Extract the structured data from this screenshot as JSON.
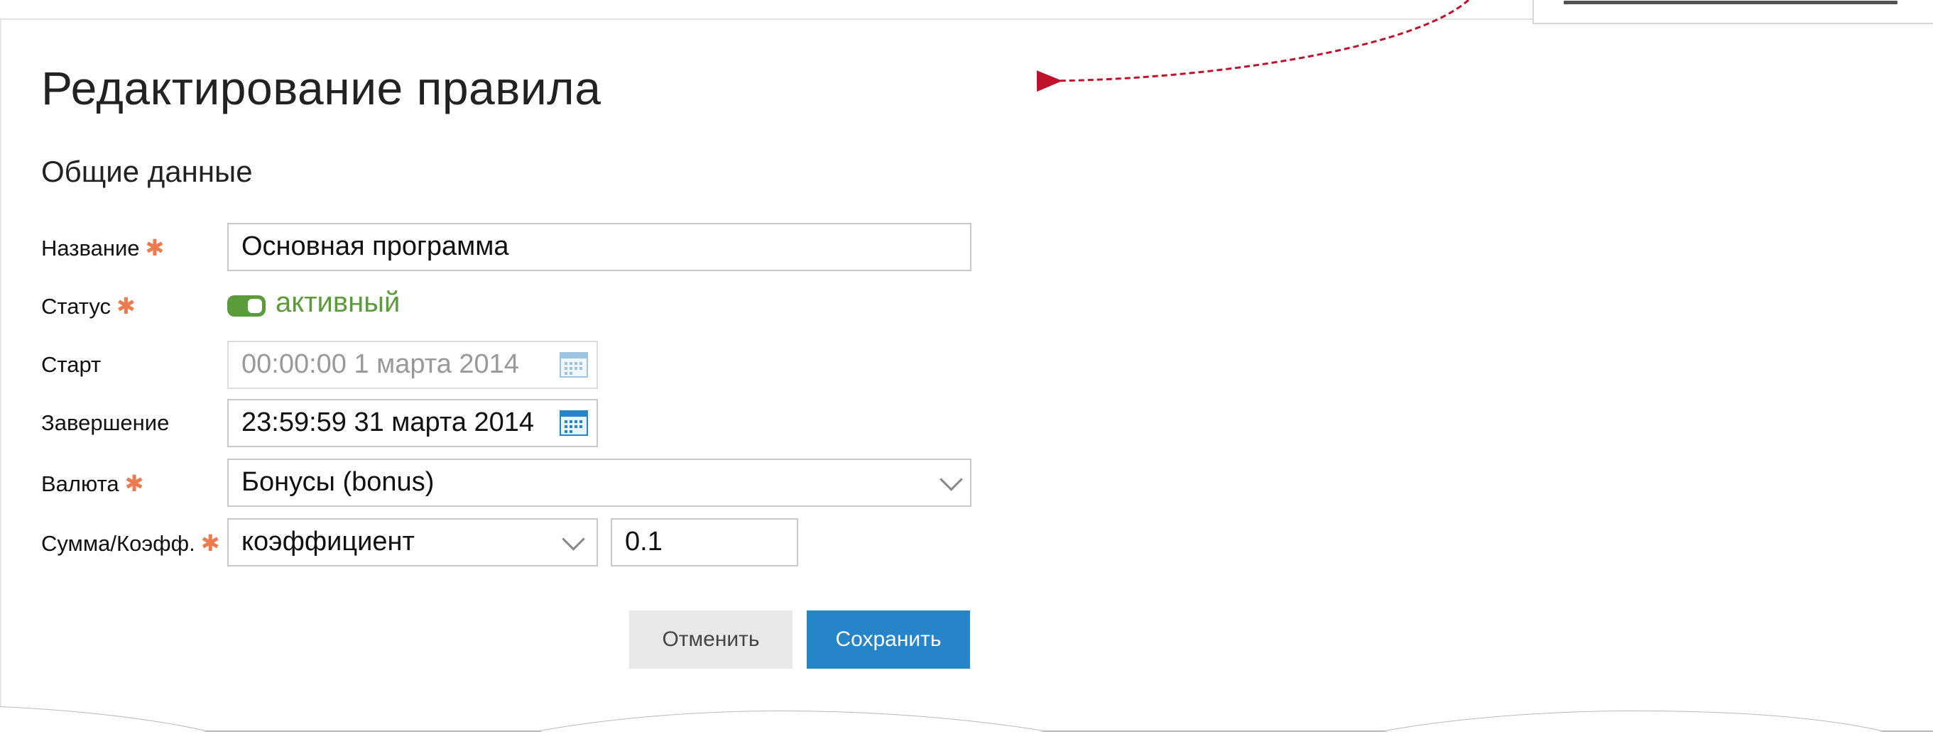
{
  "page": {
    "title": "Редактирование правила",
    "section_title": "Общие данные"
  },
  "form": {
    "name": {
      "label": "Название",
      "value": "Основная программа",
      "required": true
    },
    "status": {
      "label": "Статус",
      "value": "активный",
      "enabled": true,
      "required": true
    },
    "start": {
      "label": "Старт",
      "value": "00:00:00  1 марта 2014",
      "disabled": true
    },
    "end": {
      "label": "Завершение",
      "value": "23:59:59  31 марта 2014"
    },
    "currency": {
      "label": "Валюта",
      "value": "Бонусы (bonus)",
      "required": true
    },
    "amount": {
      "label": "Сумма/Коэфф.",
      "type_value": "коэффициент",
      "value": "0.1",
      "required": true
    }
  },
  "buttons": {
    "cancel": "Отменить",
    "save": "Сохранить"
  },
  "colors": {
    "accent": "#2585c8",
    "active": "#5b9b3a",
    "required": "#ee7a4f",
    "arrow": "#c0102a"
  },
  "icons": [
    "calendar-icon",
    "chevron-down-icon",
    "asterisk-icon"
  ]
}
